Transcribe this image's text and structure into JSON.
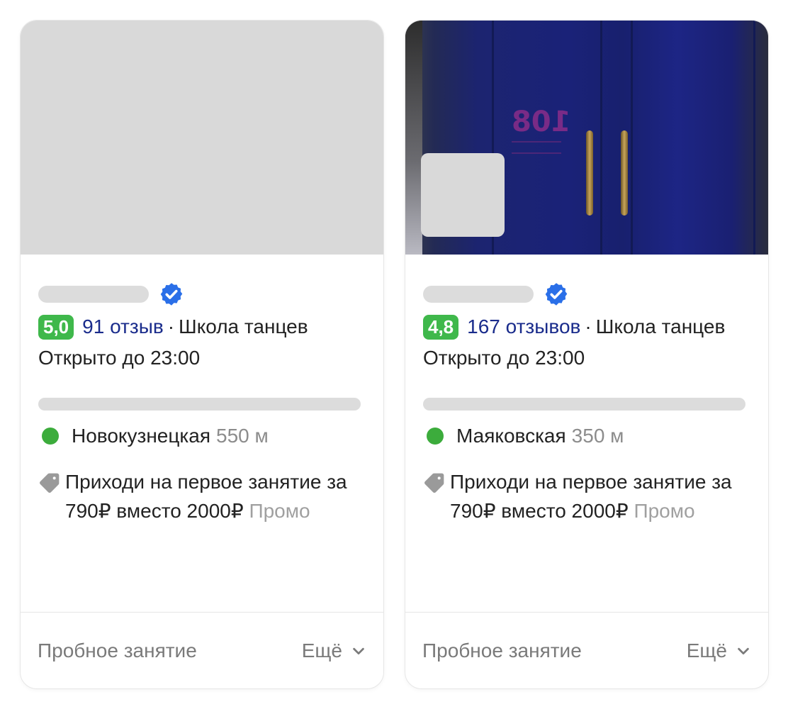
{
  "cards": [
    {
      "rating": "5,0",
      "reviews": "91 отзыв",
      "separator": "·",
      "category": "Школа танцев",
      "hours": "Открыто до 23:00",
      "metro": "Новокузнецкая",
      "metro_color": "#3cac3c",
      "distance": "550 м",
      "promo_text": "Приходи на первое занятие за 790₽ вместо 2000₽",
      "promo_badge": "Промо",
      "footer_action": "Пробное занятие",
      "more_label": "Ещё"
    },
    {
      "rating": "4,8",
      "reviews": "167 отзывов",
      "separator": "·",
      "category": "Школа танцев",
      "hours": "Открыто до 23:00",
      "metro": "Маяковская",
      "metro_color": "#3cac3c",
      "distance": "350 м",
      "promo_text": "Приходи на первое занятие за 790₽ вместо 2000₽",
      "promo_badge": "Промо",
      "footer_action": "Пробное занятие",
      "more_label": "Ещё",
      "photo_sign": "108"
    }
  ],
  "colors": {
    "rating_badge": "#3fb84b",
    "link": "#1a2c8c",
    "verified": "#2a6fe8",
    "skeleton": "#dcdcdc"
  },
  "icons": {
    "verified": "verified-check-icon",
    "tag": "tag-icon",
    "chevron": "chevron-down-icon"
  }
}
